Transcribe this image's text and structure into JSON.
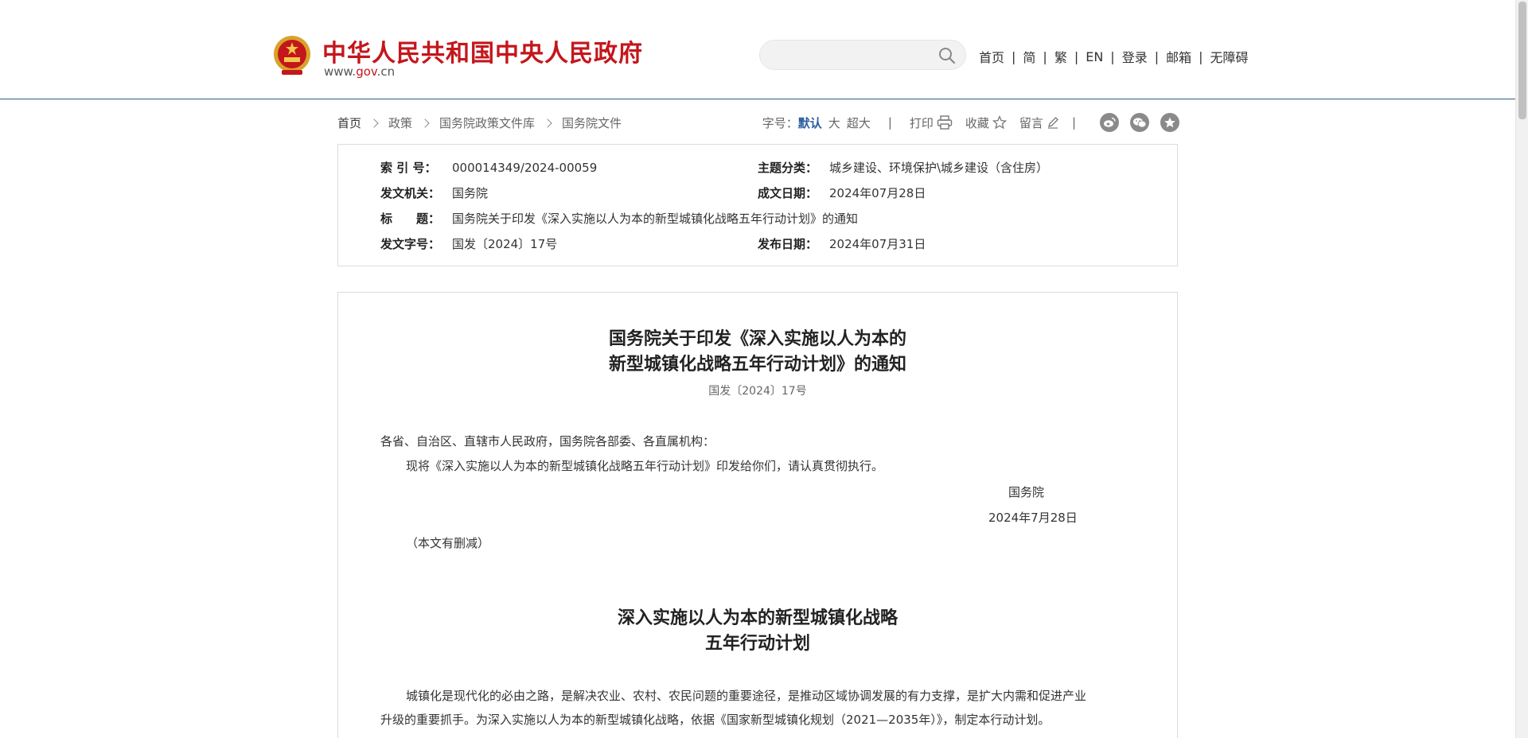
{
  "header": {
    "site_title": "中华人民共和国中央人民政府",
    "url_prefix": "www.",
    "url_brand": "gov",
    "url_suffix": ".cn",
    "search": {
      "placeholder": ""
    },
    "nav": [
      "首页",
      "简",
      "繁",
      "EN",
      "登录",
      "邮箱",
      "无障碍"
    ],
    "nav_separator": "|"
  },
  "breadcrumb": [
    "首页",
    "政策",
    "国务院政策文件库",
    "国务院文件"
  ],
  "tools": {
    "font_size_label": "字号：",
    "font_sizes": [
      "默认",
      "大",
      "超大"
    ],
    "separator": "|",
    "print": "打印",
    "favorite": "收藏",
    "comment": "留言",
    "share_icons": [
      "weibo-icon",
      "wechat-icon",
      "star-icon"
    ]
  },
  "info": {
    "index_no_label": "索 引 号：",
    "index_no": "000014349/2024-00059",
    "topic_label": "主题分类：",
    "topic": "城乡建设、环境保护\\城乡建设（含住房）",
    "issuer_label": "发文机关：",
    "issuer": "国务院",
    "written_date_label": "成文日期：",
    "written_date": "2024年07月28日",
    "title_label": "标　　题：",
    "title": "国务院关于印发《深入实施以人为本的新型城镇化战略五年行动计划》的通知",
    "doc_no_label": "发文字号：",
    "doc_no": "国发〔2024〕17号",
    "publish_date_label": "发布日期：",
    "publish_date": "2024年07月31日"
  },
  "article": {
    "title_line1": "国务院关于印发《深入实施以人为本的",
    "title_line2": "新型城镇化战略五年行动计划》的通知",
    "doc_no": "国发〔2024〕17号",
    "salutation": "各省、自治区、直辖市人民政府，国务院各部委、各直属机构：",
    "body1": "现将《深入实施以人为本的新型城镇化战略五年行动计划》印发给你们，请认真贯彻执行。",
    "signature": "国务院",
    "sign_date": "2024年7月28日",
    "note": "（本文有删减）",
    "plan_title_line1": "深入实施以人为本的新型城镇化战略",
    "plan_title_line2": "五年行动计划",
    "plan_para_line1": "城镇化是现代化的必由之路，是解决农业、农村、农民问题的重要途径，是推动区域协调发展的有力支撑，是扩大内需和促进产业",
    "plan_para_line2": "升级的重要抓手。为深入实施以人为本的新型城镇化战略，依据《国家新型城镇化规划（2021—2035年）》，制定本行动计划。"
  },
  "colors": {
    "brand_red": "#c4161c",
    "header_rule": "#2f5d8b",
    "active_blue": "#2a5d9f"
  }
}
